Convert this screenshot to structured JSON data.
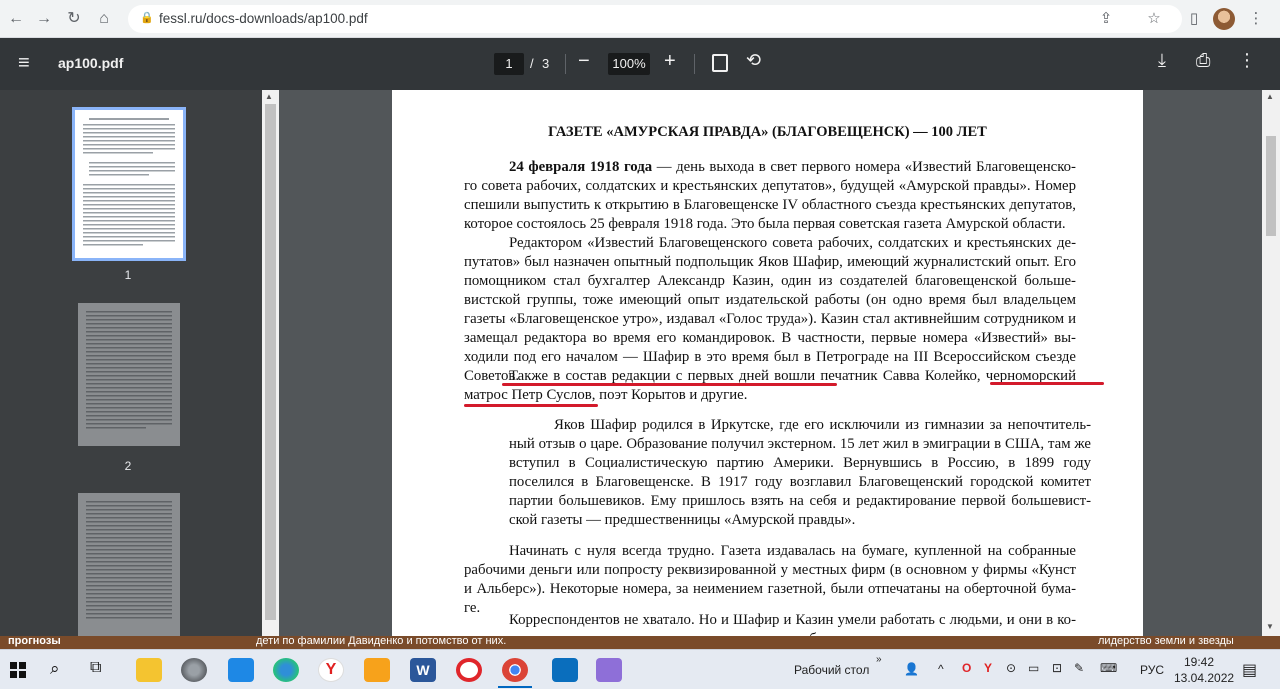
{
  "browser": {
    "url": "fessl.ru/docs-downloads/ap100.pdf"
  },
  "viewer": {
    "filename": "ap100.pdf",
    "current_page": "1",
    "page_sep": "/",
    "total_pages": "3",
    "zoom": "100%",
    "thumbnails": [
      {
        "label": "1"
      },
      {
        "label": "2"
      }
    ]
  },
  "document": {
    "title": "ГАЗЕТЕ «АМУРСКАЯ ПРАВДА» (БЛАГОВЕЩЕНСК) — 100 ЛЕТ",
    "p1_bold": "24 февраля 1918 года",
    "p1_rest": " — день выхода в свет первого номера «Известий Благовещенско-го совета рабочих, солдатских и крестьянских депутатов», будущей «Амурской правды». Номер спешили выпустить к открытию в Благовещенске IV областного съезда крестьянских депутатов, которое состоялось 25 февраля 1918 года. Это была первая советская газета Амурской области.",
    "p2": "Редактором «Известий Благовещенского совета рабочих, солдатских и крестьянских де-путатов» был назначен опытный подпольщик Яков Шафир, имеющий журналистский опыт. Его помощником стал бухгалтер Александр Казин, один из создателей благовещенской больше-вистской группы, тоже имеющий опыт издательской работы (он одно время был владельцем газеты «Благовещенское утро», издавал «Голос труда»). Казин стал активнейшим сотрудником и замещал редактора во время его командировок. В частности, первые номера «Известий» вы-ходили под его началом — Шафир в это время был в Петрограде на III Всероссийском съезде Советов.",
    "p3": "Также в состав редакции с первых дней вошли печатник Савва Колейко, черноморский матрос Петр Суслов, поэт Корытов и другие.",
    "p4": "Яков Шафир родился в Иркутске, где его исключили из гимназии за непочтитель-ный отзыв о царе. Образование получил экстерном. 15 лет жил в эмиграции в США, там же вступил в Социалистическую партию Америки. Вернувшись в Россию, в 1899 году поселился в Благовещенске. В 1917 году возглавил Благовещенский городской комитет партии большевиков. Ему пришлось взять на себя и редактирование первой большевист-ской газеты — предшественницы «Амурской правды».",
    "p5": "Начинать с нуля всегда трудно. Газета издавалась на бумаге, купленной на собранные рабочими деньги или попросту реквизированной у местных фирм (в основном у фирмы «Кунст и Альберс»). Некоторые номера, за неимением газетной, были отпечатаны на оберточной бума-ге.",
    "p6": "Корреспондентов не хватало. Но и Шафир и Казин умели работать с людьми, и они в ко-роткие сроки привлекли к участию в газете десятки добровольных сотрудников, селькоров и"
  },
  "news": {
    "left": "прогнозы",
    "middle": "дети по фамилии Давиденко и потомство от них.",
    "right": "лидерство земли и звезды"
  },
  "taskbar": {
    "desktop_label": "Рабочий стол",
    "lang": "РУС",
    "time": "19:42",
    "date": "13.04.2022"
  },
  "colors": {
    "toolbar": "#323639",
    "underline": "#d31a2b",
    "sidebar": "#3c3f41"
  }
}
